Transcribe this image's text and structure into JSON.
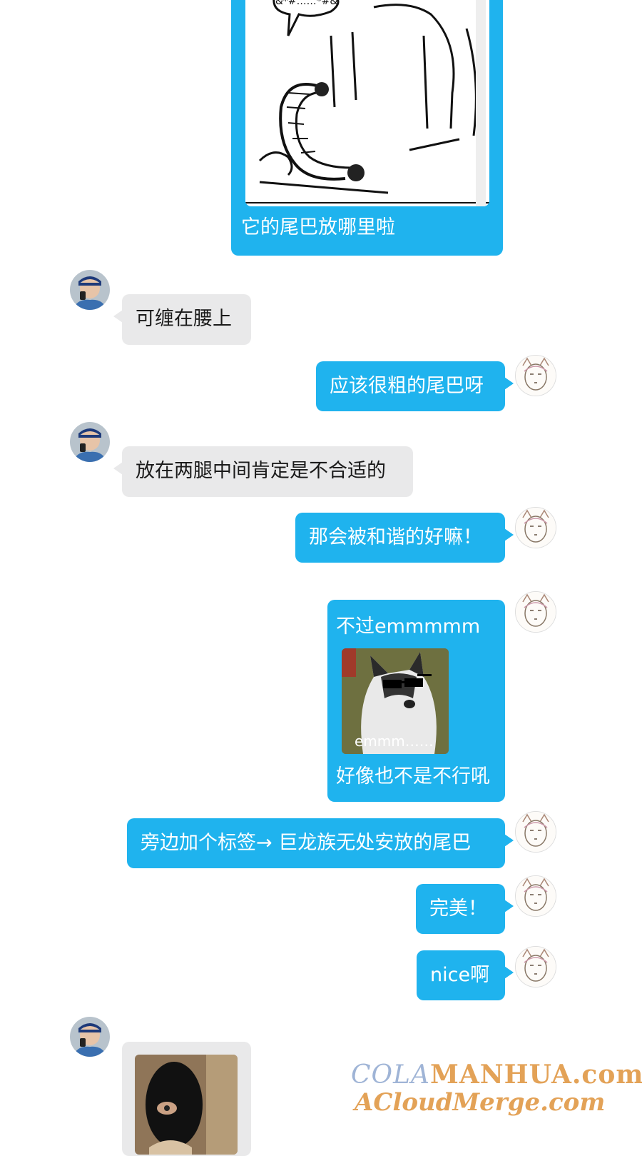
{
  "colors": {
    "me_bubble": "#1fb3ee",
    "them_bubble": "#e9e9ea",
    "accent": "#1fb3ee"
  },
  "messages": [
    {
      "from": "me",
      "type": "image-with-caption",
      "image": "drawing-dragon-sketch",
      "sketch_text": "&*#……*#&",
      "caption": "它的尾巴放哪里啦"
    },
    {
      "from": "them",
      "type": "text",
      "text": "可缠在腰上"
    },
    {
      "from": "me",
      "type": "text",
      "text": "应该很粗的尾巴呀"
    },
    {
      "from": "them",
      "type": "text",
      "text": "放在两腿中间肯定是不合适的"
    },
    {
      "from": "me",
      "type": "text",
      "text": "那会被和谐的好嘛！"
    },
    {
      "from": "me",
      "type": "text-image-text",
      "text_top": "不过emmmmm",
      "image": "husky-sunglasses-meme",
      "image_caption": "emmm……",
      "text_bottom": "好像也不是不行吼"
    },
    {
      "from": "me",
      "type": "text",
      "text": "旁边加个标签→ 巨龙族无处安放的尾巴"
    },
    {
      "from": "me",
      "type": "text",
      "text": "完美！"
    },
    {
      "from": "me",
      "type": "text",
      "text": "nice啊"
    },
    {
      "from": "them",
      "type": "image",
      "image": "masked-dog-photo"
    }
  ],
  "avatars": {
    "them": "elderly-man-avatar",
    "me": "sketch-girl-avatar"
  },
  "watermark": {
    "line1_part1": "COLA",
    "line1_part2": "MANHUA",
    "line1_part3": ".com",
    "line2": "ACloudMerge.com"
  }
}
